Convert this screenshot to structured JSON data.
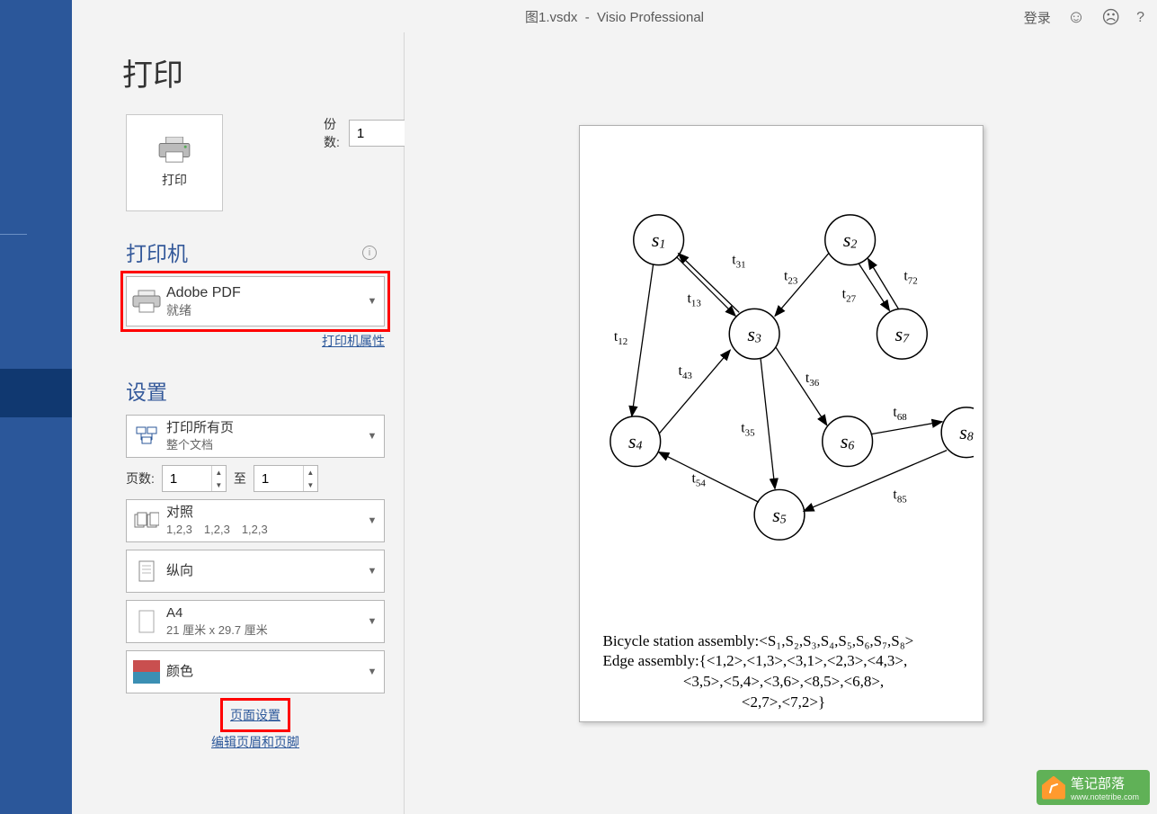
{
  "titlebar": {
    "doc": "图1.vsdx",
    "sep": "-",
    "app": "Visio Professional",
    "login": "登录",
    "help": "?"
  },
  "page": {
    "title": "打印",
    "print_btn": "打印",
    "copies_label": "份数:",
    "copies_value": "1"
  },
  "printer_section": {
    "heading": "打印机",
    "selected_name": "Adobe PDF",
    "selected_status": "就绪",
    "props_link": "打印机属性"
  },
  "settings_section": {
    "heading": "设置",
    "scope": {
      "line1": "打印所有页",
      "line2": "整个文档"
    },
    "pages": {
      "label": "页数:",
      "from": "1",
      "to_label": "至",
      "to": "1"
    },
    "collate": {
      "line1": "对照",
      "line2": "1,2,3　1,2,3　1,2,3"
    },
    "orient": {
      "line1": "纵向"
    },
    "paper": {
      "line1": "A4",
      "line2": "21 厘米 x 29.7 厘米"
    },
    "color": {
      "line1": "颜色"
    },
    "page_setup_link": "页面设置",
    "headerfooter_link": "编辑页眉和页脚"
  },
  "diagram": {
    "nodes": [
      "s1",
      "s2",
      "s3",
      "s4",
      "s5",
      "s6",
      "s7",
      "s8"
    ],
    "edge_labels": [
      "t31",
      "t23",
      "t13",
      "t27",
      "t72",
      "t12",
      "t43",
      "t36",
      "t35",
      "t68",
      "t54",
      "t85"
    ],
    "desc_l1_prefix": "Bicycle station assembly:",
    "desc_l1_set": "<S₁,S₂,S₃,S₄,S₅,S₆,S₇,S₈>",
    "desc_l2_prefix": "Edge assembly:",
    "desc_l2a": "{<1,2>,<1,3>,<3,1>,<2,3>,<4,3>,",
    "desc_l2b": "<3,5>,<5,4>,<3,6>,<8,5>,<6,8>,",
    "desc_l2c": "<2,7>,<7,2>}"
  },
  "watermark": {
    "text": "笔记部落",
    "sub": "www.notetribe.com"
  }
}
